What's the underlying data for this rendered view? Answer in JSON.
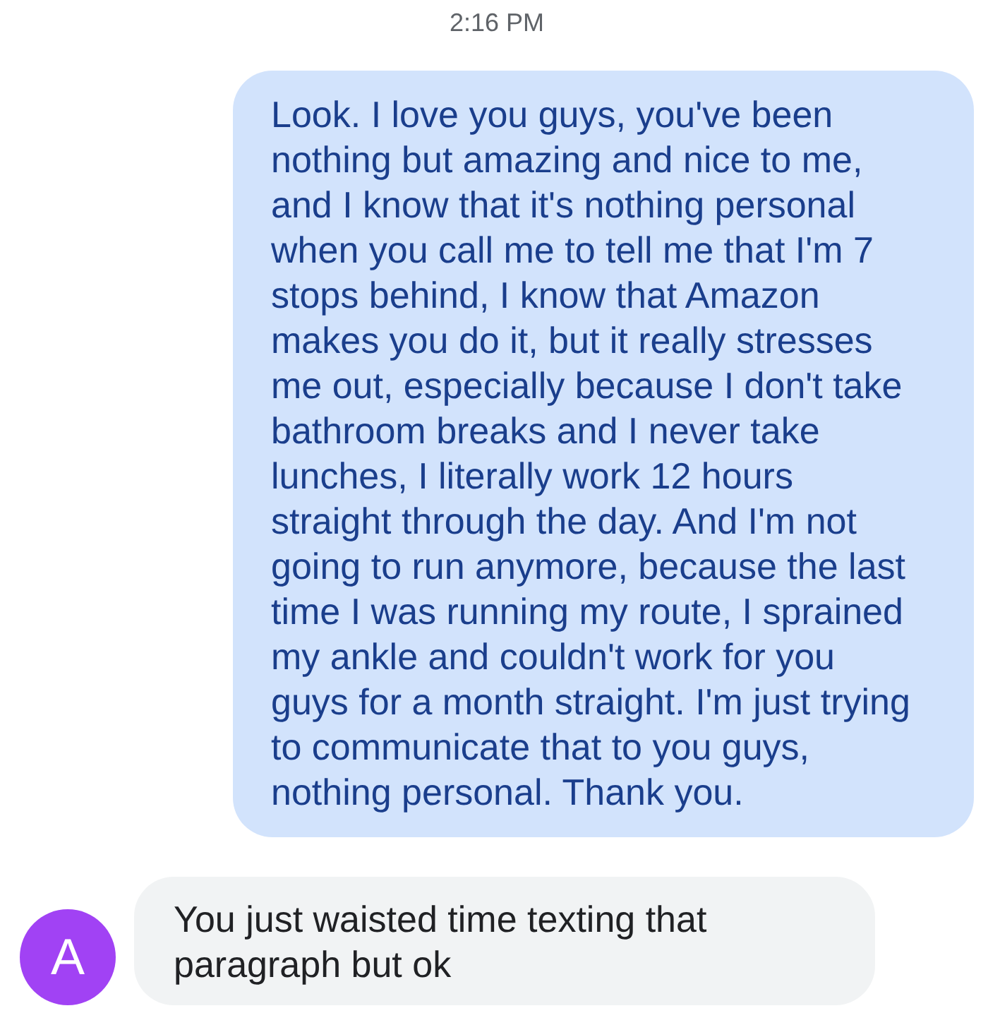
{
  "timestamp": "2:16 PM",
  "messages": [
    {
      "kind": "sent",
      "text": "Look. I love you guys, you've been nothing but amazing and nice to me, and I know that it's nothing personal when you call me to tell me that I'm 7 stops behind, I know that Amazon makes you do it, but it really stresses me out, especially because I don't take bathroom breaks and I never take lunches, I literally work 12 hours straight through the day. And I'm not going to run anymore, because the last time I was running my route, I sprained my ankle and couldn't work for you guys for a month straight. I'm just trying to communicate that to you guys, nothing personal. Thank you."
    },
    {
      "kind": "received",
      "text": "You just waisted time texting that paragraph but ok",
      "avatar": "A",
      "color": "#a142f4"
    }
  ]
}
